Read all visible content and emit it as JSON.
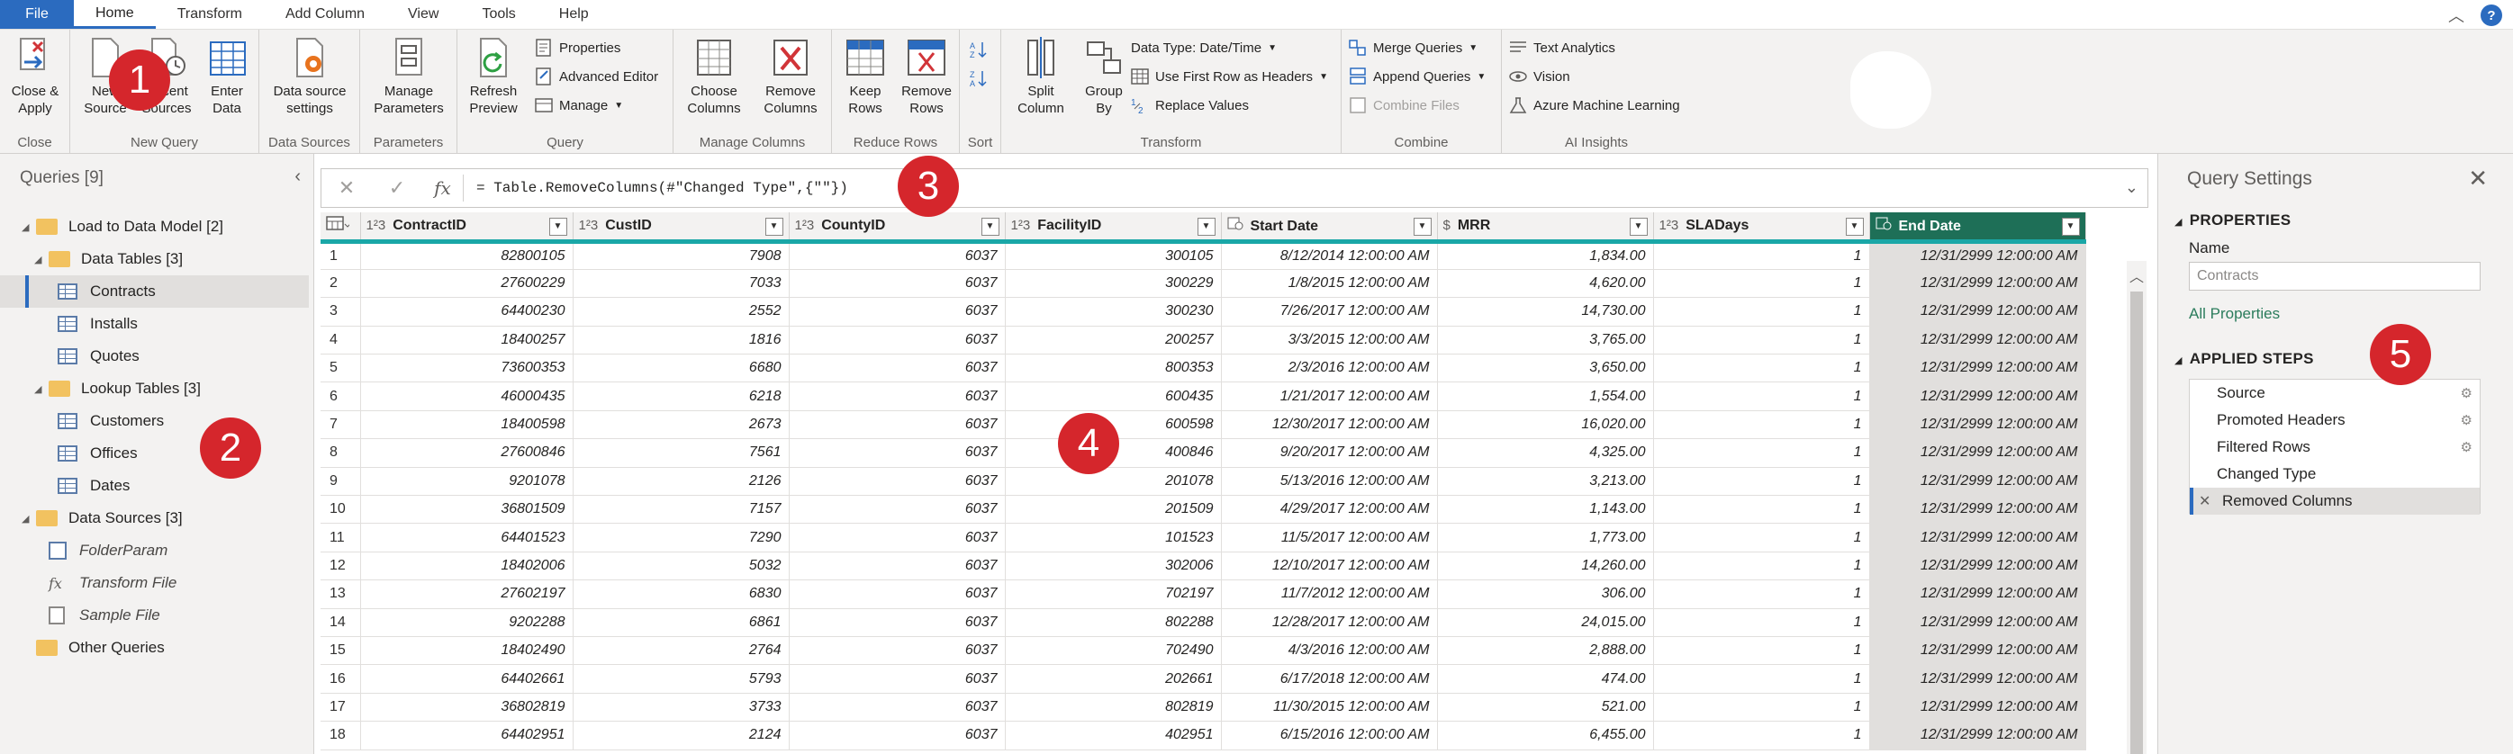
{
  "menu": {
    "tabs": [
      "File",
      "Home",
      "Transform",
      "Add Column",
      "View",
      "Tools",
      "Help"
    ],
    "help": "?"
  },
  "ribbon": {
    "close_apply": "Close &\nApply",
    "new_source": "New\nSource",
    "recent_sources": "Recent\nSources",
    "enter_data": "Enter\nData",
    "data_source_settings": "Data source\nsettings",
    "manage_parameters": "Manage\nParameters",
    "refresh_preview": "Refresh\nPreview",
    "properties": "Properties",
    "advanced_editor": "Advanced Editor",
    "manage": "Manage",
    "choose_columns": "Choose\nColumns",
    "remove_columns": "Remove\nColumns",
    "keep_rows": "Keep\nRows",
    "remove_rows": "Remove\nRows",
    "split_column": "Split\nColumn",
    "group_by": "Group\nBy",
    "data_type": "Data Type: Date/Time",
    "use_first_row": "Use First Row as Headers",
    "replace_values": "Replace Values",
    "merge_queries": "Merge Queries",
    "append_queries": "Append Queries",
    "combine_files": "Combine Files",
    "text_analytics": "Text Analytics",
    "vision": "Vision",
    "azure_ml": "Azure Machine Learning",
    "groups": [
      "Close",
      "New Query",
      "Data Sources",
      "Parameters",
      "Query",
      "Manage Columns",
      "Reduce Rows",
      "Sort",
      "Transform",
      "Combine",
      "AI Insights"
    ]
  },
  "queries": {
    "title": "Queries [9]",
    "items": [
      {
        "label": "Load to Data Model [2]",
        "kind": "folder",
        "level": 0
      },
      {
        "label": "Data Tables [3]",
        "kind": "folder",
        "level": 1
      },
      {
        "label": "Contracts",
        "kind": "table",
        "level": 2
      },
      {
        "label": "Installs",
        "kind": "table",
        "level": 2
      },
      {
        "label": "Quotes",
        "kind": "table",
        "level": 2
      },
      {
        "label": "Lookup Tables [3]",
        "kind": "folder",
        "level": 1
      },
      {
        "label": "Customers",
        "kind": "table",
        "level": 2
      },
      {
        "label": "Offices",
        "kind": "table",
        "level": 2
      },
      {
        "label": "Dates",
        "kind": "table",
        "level": 2
      },
      {
        "label": "Data Sources [3]",
        "kind": "folder",
        "level": 0
      },
      {
        "label": "FolderParam",
        "kind": "param",
        "level": 2
      },
      {
        "label": "Transform File",
        "kind": "fx",
        "level": 2
      },
      {
        "label": "Sample File",
        "kind": "file",
        "level": 2
      },
      {
        "label": "Other Queries",
        "kind": "folder",
        "level": 0
      }
    ]
  },
  "formula": {
    "text": "= Table.RemoveColumns(#\"Changed Type\",{\"\"})",
    "fx": "fx"
  },
  "grid": {
    "columns": [
      {
        "type": "1²3",
        "name": "ContractID"
      },
      {
        "type": "1²3",
        "name": "CustID"
      },
      {
        "type": "1²3",
        "name": "CountyID"
      },
      {
        "type": "1²3",
        "name": "FacilityID"
      },
      {
        "type": "",
        "name": "Start Date"
      },
      {
        "type": "$",
        "name": "MRR"
      },
      {
        "type": "1²3",
        "name": "SLADays"
      },
      {
        "type": "",
        "name": "End Date"
      }
    ],
    "rows": [
      [
        "82800105",
        "7908",
        "6037",
        "300105",
        "8/12/2014 12:00:00 AM",
        "1,834.00",
        "1",
        "12/31/2999 12:00:00 AM"
      ],
      [
        "27600229",
        "7033",
        "6037",
        "300229",
        "1/8/2015 12:00:00 AM",
        "4,620.00",
        "1",
        "12/31/2999 12:00:00 AM"
      ],
      [
        "64400230",
        "2552",
        "6037",
        "300230",
        "7/26/2017 12:00:00 AM",
        "14,730.00",
        "1",
        "12/31/2999 12:00:00 AM"
      ],
      [
        "18400257",
        "1816",
        "6037",
        "200257",
        "3/3/2015 12:00:00 AM",
        "3,765.00",
        "1",
        "12/31/2999 12:00:00 AM"
      ],
      [
        "73600353",
        "6680",
        "6037",
        "800353",
        "2/3/2016 12:00:00 AM",
        "3,650.00",
        "1",
        "12/31/2999 12:00:00 AM"
      ],
      [
        "46000435",
        "6218",
        "6037",
        "600435",
        "1/21/2017 12:00:00 AM",
        "1,554.00",
        "1",
        "12/31/2999 12:00:00 AM"
      ],
      [
        "18400598",
        "2673",
        "6037",
        "600598",
        "12/30/2017 12:00:00 AM",
        "16,020.00",
        "1",
        "12/31/2999 12:00:00 AM"
      ],
      [
        "27600846",
        "7561",
        "6037",
        "400846",
        "9/20/2017 12:00:00 AM",
        "4,325.00",
        "1",
        "12/31/2999 12:00:00 AM"
      ],
      [
        "9201078",
        "2126",
        "6037",
        "201078",
        "5/13/2016 12:00:00 AM",
        "3,213.00",
        "1",
        "12/31/2999 12:00:00 AM"
      ],
      [
        "36801509",
        "7157",
        "6037",
        "201509",
        "4/29/2017 12:00:00 AM",
        "1,143.00",
        "1",
        "12/31/2999 12:00:00 AM"
      ],
      [
        "64401523",
        "7290",
        "6037",
        "101523",
        "11/5/2017 12:00:00 AM",
        "1,773.00",
        "1",
        "12/31/2999 12:00:00 AM"
      ],
      [
        "18402006",
        "5032",
        "6037",
        "302006",
        "12/10/2017 12:00:00 AM",
        "14,260.00",
        "1",
        "12/31/2999 12:00:00 AM"
      ],
      [
        "27602197",
        "6830",
        "6037",
        "702197",
        "11/7/2012 12:00:00 AM",
        "306.00",
        "1",
        "12/31/2999 12:00:00 AM"
      ],
      [
        "9202288",
        "6861",
        "6037",
        "802288",
        "12/28/2017 12:00:00 AM",
        "24,015.00",
        "1",
        "12/31/2999 12:00:00 AM"
      ],
      [
        "18402490",
        "2764",
        "6037",
        "702490",
        "4/3/2016 12:00:00 AM",
        "2,888.00",
        "1",
        "12/31/2999 12:00:00 AM"
      ],
      [
        "64402661",
        "5793",
        "6037",
        "202661",
        "6/17/2018 12:00:00 AM",
        "474.00",
        "1",
        "12/31/2999 12:00:00 AM"
      ],
      [
        "36802819",
        "3733",
        "6037",
        "802819",
        "11/30/2015 12:00:00 AM",
        "521.00",
        "1",
        "12/31/2999 12:00:00 AM"
      ],
      [
        "64402951",
        "2124",
        "6037",
        "402951",
        "6/15/2016 12:00:00 AM",
        "6,455.00",
        "1",
        "12/31/2999 12:00:00 AM"
      ]
    ]
  },
  "settings": {
    "title": "Query Settings",
    "properties_heading": "PROPERTIES",
    "name_label": "Name",
    "name_value": "Contracts",
    "all_properties": "All Properties",
    "steps_heading": "APPLIED STEPS",
    "steps": [
      "Source",
      "Promoted Headers",
      "Filtered Rows",
      "Changed Type",
      "Removed Columns"
    ]
  },
  "callouts": [
    "1",
    "2",
    "3",
    "4",
    "5"
  ],
  "colors": {
    "accent": "#2b6bbf",
    "callout": "#d5262c",
    "active_column": "#1e6f57",
    "quality_bar": "#1aa7a7"
  }
}
